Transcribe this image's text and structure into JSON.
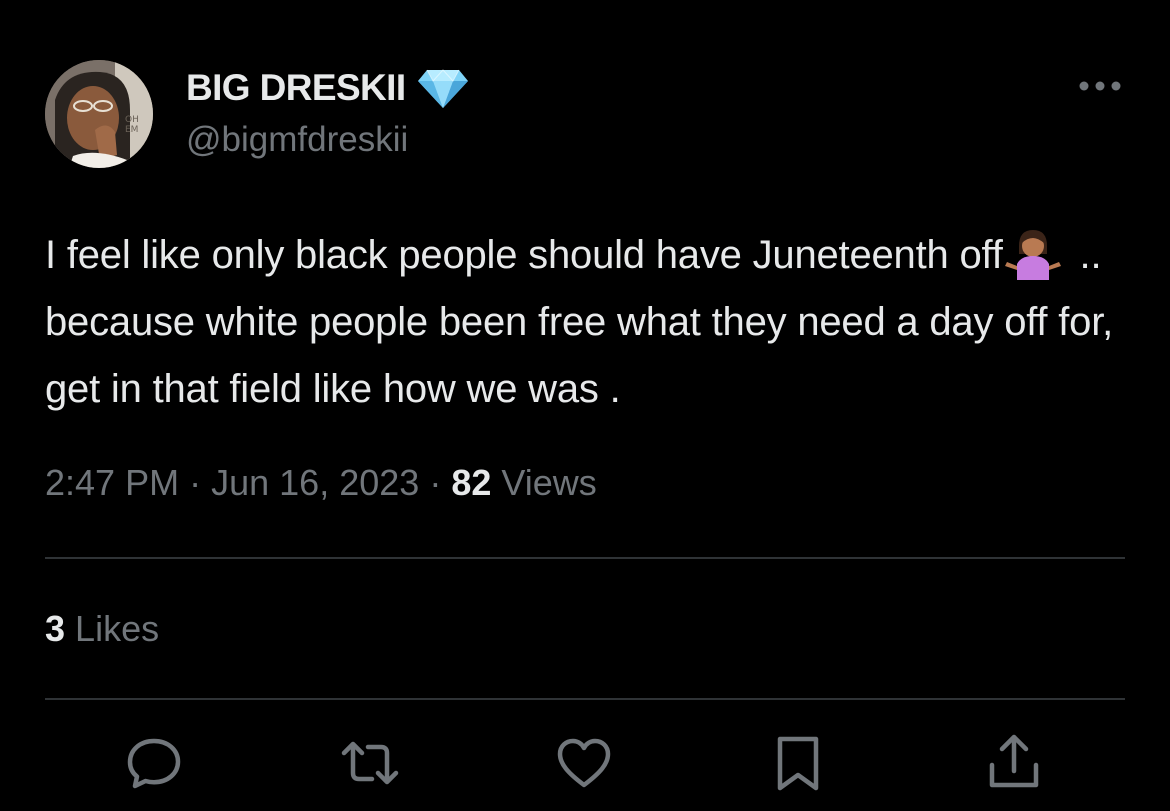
{
  "author": {
    "display_name": "BIG DRESKII",
    "badge_icon": "diamond-icon",
    "handle": "@bigmfdreskii",
    "avatar_icon": "avatar-photo"
  },
  "tweet": {
    "text_part1": "I feel like only black people should have Juneteenth off",
    "emoji_icon": "person-shrugging-emoji",
    "text_part2": " .. because white people been free what they need a day off for, get in that field like how we was ."
  },
  "meta": {
    "time": "2:47 PM",
    "separator": "·",
    "date": "Jun 16, 2023",
    "views_count": "82",
    "views_label": "Views"
  },
  "stats": {
    "likes_count": "3",
    "likes_label": "Likes"
  },
  "actions": [
    {
      "name": "reply",
      "icon": "comment-icon"
    },
    {
      "name": "retweet",
      "icon": "retweet-icon"
    },
    {
      "name": "like",
      "icon": "heart-icon"
    },
    {
      "name": "bookmark",
      "icon": "bookmark-icon"
    },
    {
      "name": "share",
      "icon": "share-icon"
    }
  ],
  "colors": {
    "background": "#000000",
    "primary_text": "#e7e9ea",
    "secondary_text": "#71767b",
    "divider": "#2f3336",
    "badge": "#7fd3f7"
  }
}
